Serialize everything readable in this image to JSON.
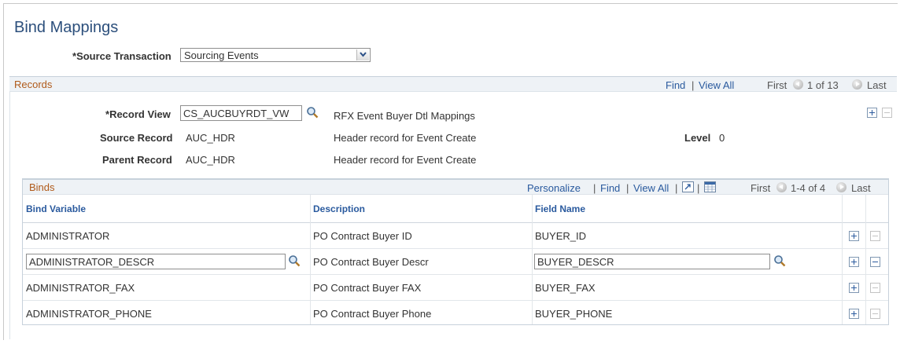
{
  "page": {
    "title": "Bind Mappings"
  },
  "source_transaction": {
    "required_marker": "*",
    "label": "Source Transaction",
    "value": "Sourcing Events"
  },
  "records": {
    "title": "Records",
    "find": "Find",
    "separator": "|",
    "view_all": "View All",
    "first": "First",
    "range": "1 of 13",
    "last": "Last",
    "record_view": {
      "required_marker": "*",
      "label": "Record View",
      "value": "CS_AUCBUYRDT_VW",
      "description": "RFX Event Buyer Dtl Mappings"
    },
    "source_record": {
      "label": "Source Record",
      "value": "AUC_HDR",
      "description": "Header record for Event Create"
    },
    "level": {
      "label": "Level",
      "value": "0"
    },
    "parent_record": {
      "label": "Parent Record",
      "value": "AUC_HDR",
      "description": "Header record for Event Create"
    }
  },
  "binds": {
    "title": "Binds",
    "personalize": "Personalize",
    "find": "Find",
    "view_all": "View All",
    "separator": "|",
    "first": "First",
    "range": "1-4 of 4",
    "last": "Last",
    "columns": [
      "Bind Variable",
      "Description",
      "Field Name"
    ],
    "rows": [
      {
        "bind_variable": "ADMINISTRATOR",
        "description": "PO Contract Buyer ID",
        "field_name": "BUYER_ID"
      },
      {
        "bind_variable": "ADMINISTRATOR_DESCR",
        "description": "PO Contract Buyer Descr",
        "field_name": "BUYER_DESCR"
      },
      {
        "bind_variable": "ADMINISTRATOR_FAX",
        "description": "PO Contract Buyer FAX",
        "field_name": "BUYER_FAX"
      },
      {
        "bind_variable": "ADMINISTRATOR_PHONE",
        "description": "PO Contract Buyer Phone",
        "field_name": "BUYER_PHONE"
      }
    ]
  },
  "icons": {
    "lookup": "magnifier-icon",
    "add_row": "plus-icon",
    "delete_row": "minus-icon",
    "previous": "previous-arrow-icon",
    "next": "next-arrow-icon",
    "zoom": "zoom-grid-icon",
    "download": "download-grid-icon"
  },
  "colors": {
    "title": "#2c4f7c",
    "section_title": "#b05a1a",
    "link": "#2a5a9e",
    "header_band": "#eef2f6"
  }
}
